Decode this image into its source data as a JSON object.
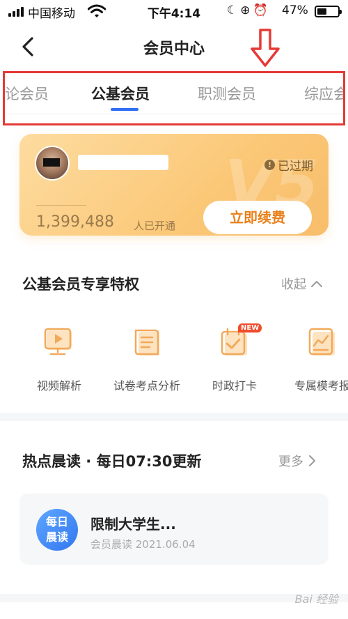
{
  "status_bar": {
    "carrier": "中国移动",
    "time": "下午4:14",
    "battery_percent": "47%",
    "battery_level": 0.47
  },
  "nav": {
    "title": "会员中心"
  },
  "tabs": [
    {
      "label": "论会员",
      "active": false
    },
    {
      "label": "公基会员",
      "active": true
    },
    {
      "label": "职测会员",
      "active": false
    },
    {
      "label": "综应会",
      "active": false
    }
  ],
  "member_card": {
    "status": "已过期",
    "count": "1,399,488",
    "count_suffix": "人已开通",
    "renew_label": "立即续费"
  },
  "privileges": {
    "title": "公基会员专享特权",
    "toggle_label": "收起",
    "items": [
      {
        "label": "视频解析",
        "icon": "video-play-icon"
      },
      {
        "label": "试卷考点分析",
        "icon": "scroll-icon"
      },
      {
        "label": "时政打卡",
        "icon": "checkin-icon",
        "badge": "NEW"
      },
      {
        "label": "专属模考报",
        "icon": "chart-report-icon"
      }
    ]
  },
  "news": {
    "title": "热点晨读 · 每日07:30更新",
    "more_label": "更多",
    "item": {
      "badge": "每日晨读",
      "badge_line1": "每日",
      "badge_line2": "晨读",
      "title": "限制大学生...",
      "meta": "会员晨读 2021.06.04"
    }
  },
  "watermark": "Bai 经验",
  "colors": {
    "accent_blue": "#2f6df5",
    "highlight_red": "#e53935",
    "card_gold": "#fbc878",
    "renew_orange": "#e8801a",
    "icon_orange": "#f2a95a"
  }
}
